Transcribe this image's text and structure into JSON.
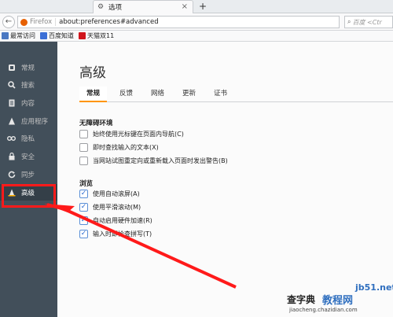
{
  "tab": {
    "title": "选项",
    "close": "×",
    "new_tab": "+"
  },
  "navbar": {
    "back": "←",
    "identity": "Firefox",
    "url": "about:preferences#advanced",
    "reload": "C",
    "search_placeholder": "百度 <Ctr"
  },
  "bookmarks": [
    {
      "label": "最常访问",
      "color": "#4a78c2"
    },
    {
      "label": "百度知道",
      "color": "#3b6fd6"
    },
    {
      "label": "天猫双11",
      "color": "#d0151c"
    }
  ],
  "sidebar": {
    "items": [
      {
        "label": "常规",
        "icon": "G"
      },
      {
        "label": "搜索",
        "icon": "Q"
      },
      {
        "label": "内容",
        "icon": "☰"
      },
      {
        "label": "应用程序",
        "icon": "A"
      },
      {
        "label": "隐私",
        "icon": "∞"
      },
      {
        "label": "安全",
        "icon": "■"
      },
      {
        "label": "同步",
        "icon": "↻"
      },
      {
        "label": "高级",
        "icon": "▲"
      }
    ]
  },
  "main": {
    "title": "高级",
    "tabs": [
      {
        "label": "常规"
      },
      {
        "label": "反馈"
      },
      {
        "label": "网络"
      },
      {
        "label": "更新"
      },
      {
        "label": "证书"
      }
    ],
    "groups": [
      {
        "title": "无障碍环境",
        "options": [
          {
            "label": "始终使用光标键在页面内导航(C)",
            "checked": false
          },
          {
            "label": "即时查找输入的文本(X)",
            "checked": false
          },
          {
            "label": "当网站试图重定向或重新载入页面时发出警告(B)",
            "checked": false
          }
        ]
      },
      {
        "title": "浏览",
        "options": [
          {
            "label": "使用自动滚屏(A)",
            "checked": true
          },
          {
            "label": "使用平滑滚动(M)",
            "checked": true
          },
          {
            "label": "自动启用硬件加速(R)",
            "checked": true
          },
          {
            "label": "输入时即检查拼写(T)",
            "checked": true
          }
        ]
      }
    ]
  },
  "watermark": {
    "site": "jb51.net",
    "brand": "教程网",
    "brand_prefix": "查字典",
    "url": "jiaocheng.chazidian.com"
  },
  "colors": {
    "sidebar": "#424f5a",
    "accent": "#ff9500",
    "annotation": "#ff1a1a"
  }
}
